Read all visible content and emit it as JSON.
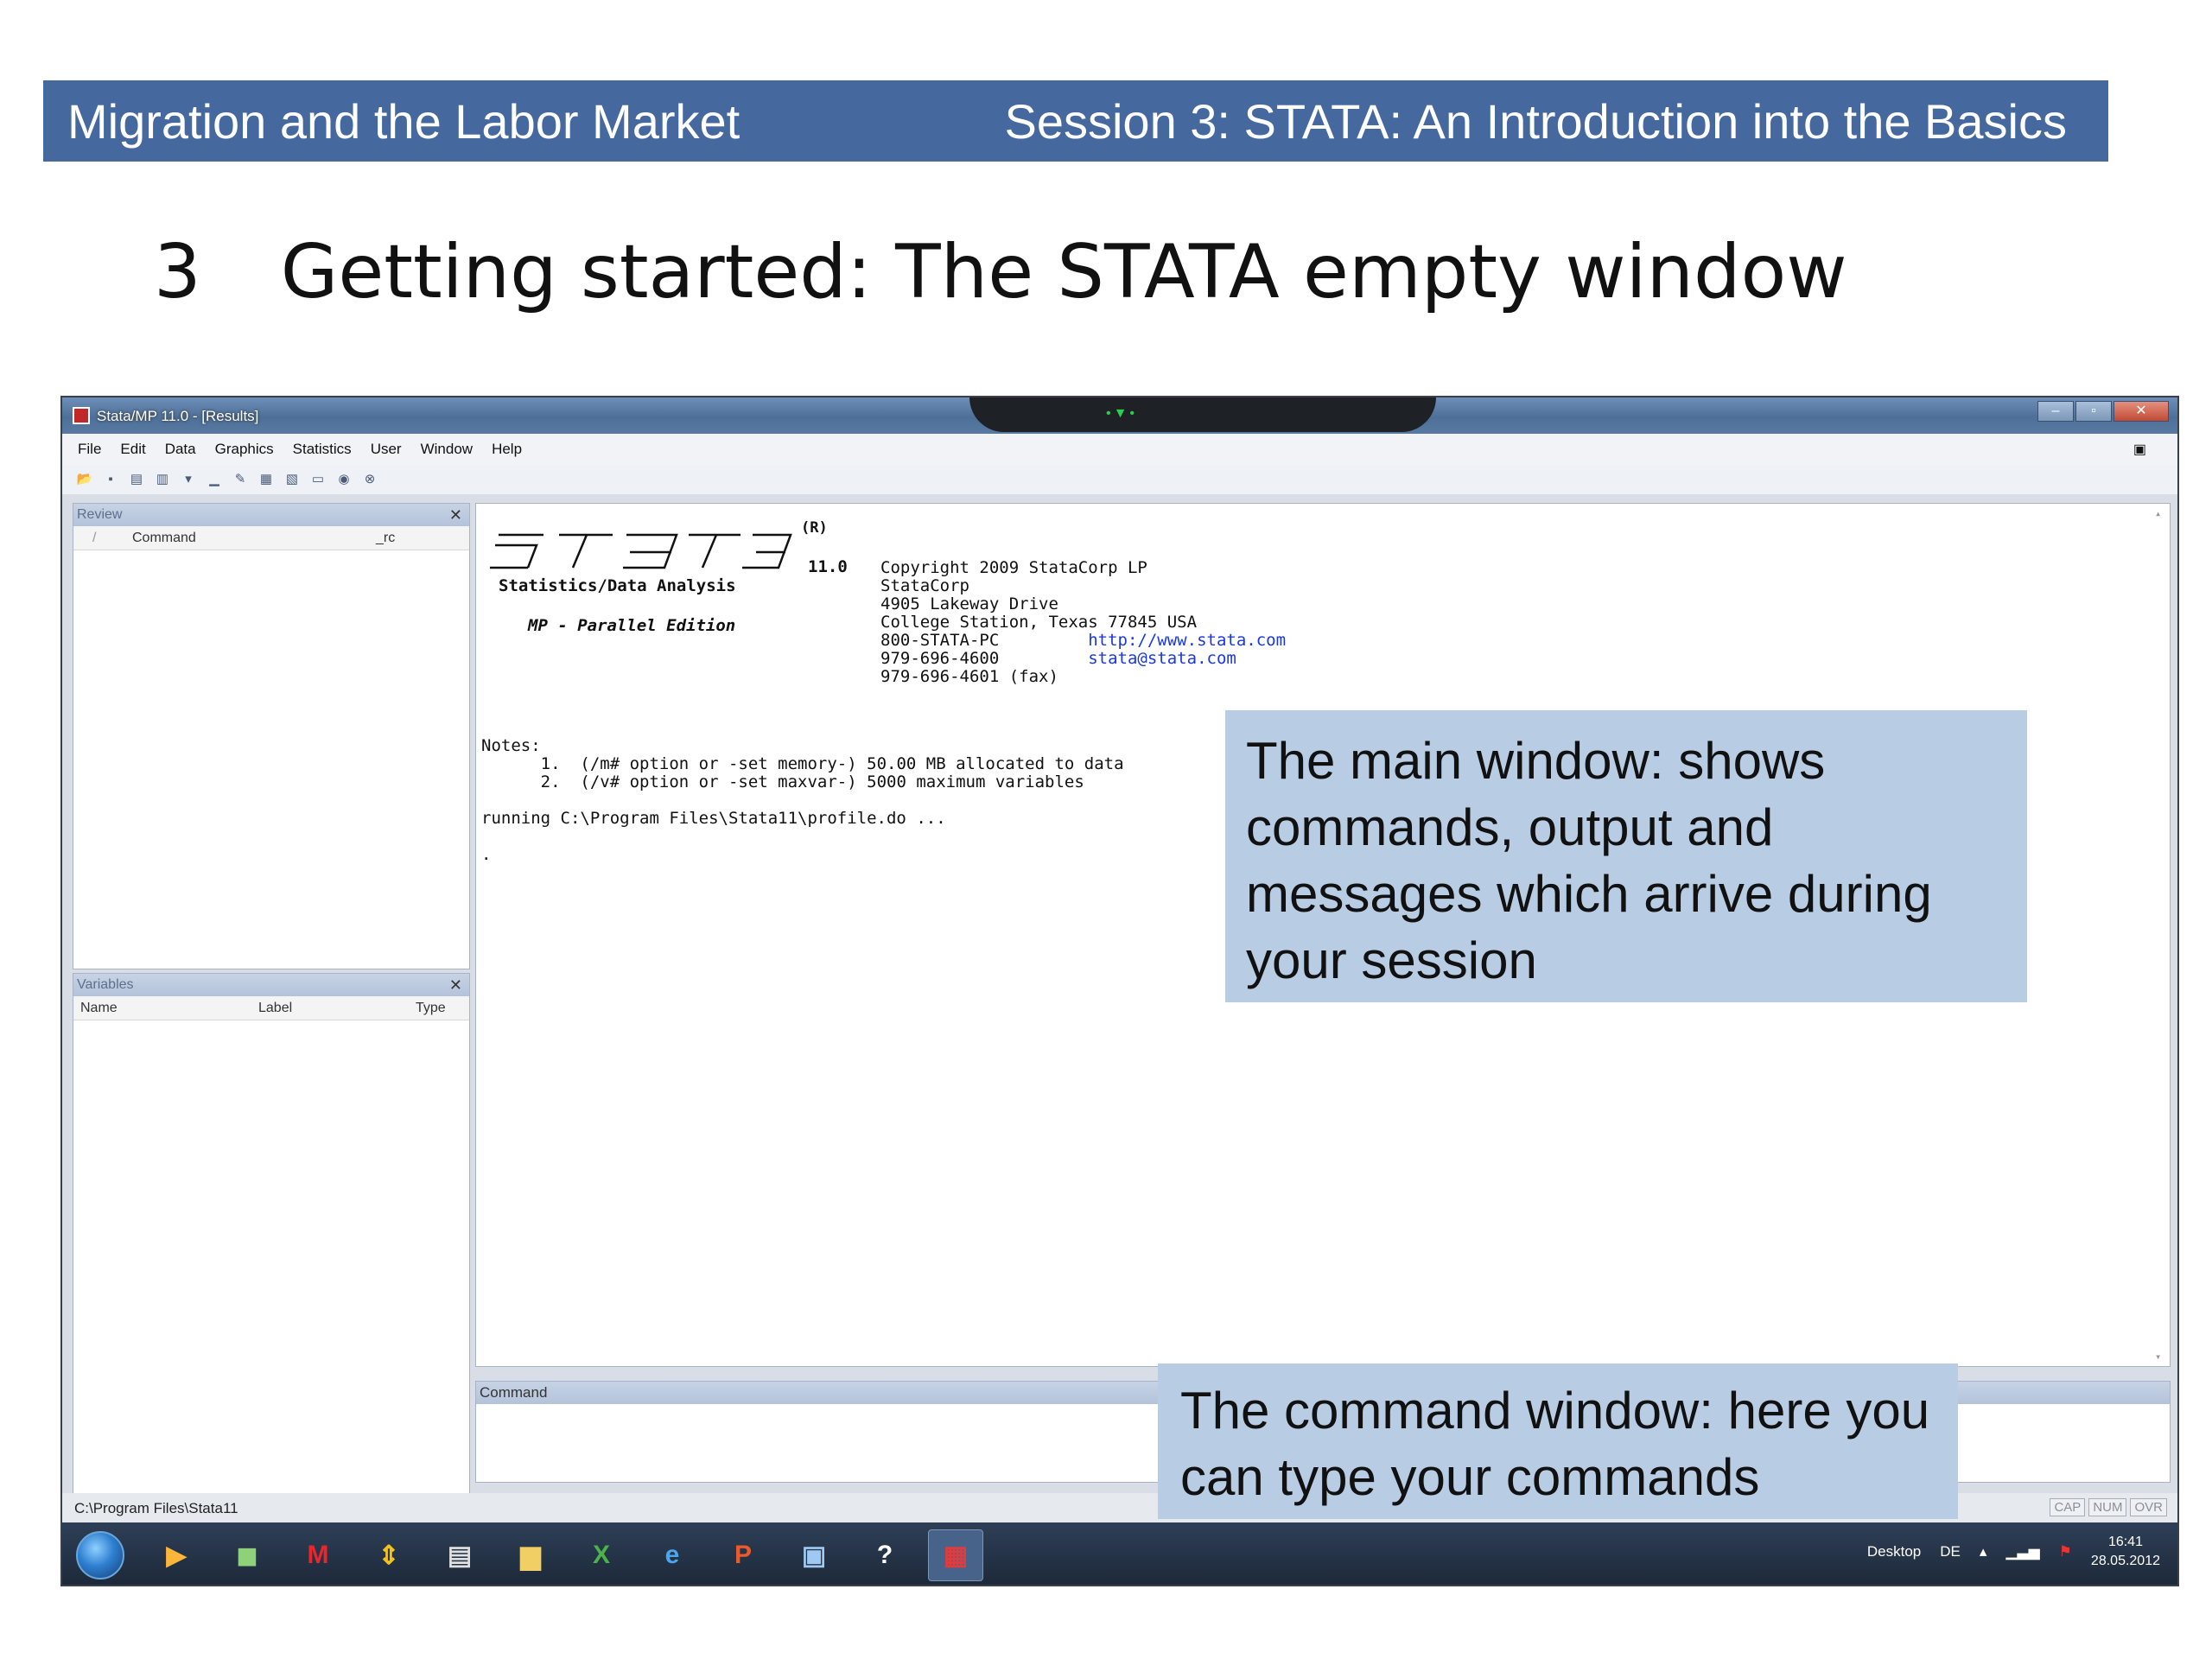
{
  "slide": {
    "header_left": "Migration and the Labor Market",
    "header_right": "Session 3: STATA: An Introduction into the Basics",
    "section_number": "3",
    "title": "Getting started: The STATA empty window"
  },
  "window": {
    "title": "Stata/MP 11.0 - [Results]",
    "menu": [
      "File",
      "Edit",
      "Data",
      "Graphics",
      "Statistics",
      "User",
      "Window",
      "Help"
    ]
  },
  "review": {
    "title": "Review",
    "columns": [
      "/",
      "Command",
      "_rc"
    ]
  },
  "variables": {
    "title": "Variables",
    "columns": [
      "Name",
      "Label",
      "Type"
    ]
  },
  "results": {
    "registered": "(R)",
    "version": "11.0",
    "subtitle": "Statistics/Data Analysis",
    "edition": "MP - Parallel Edition",
    "copyright_lines": [
      "Copyright 2009 StataCorp LP",
      "StataCorp",
      "4905 Lakeway Drive",
      "College Station, Texas 77845 USA",
      "800-STATA-PC",
      "979-696-4600",
      "979-696-4601 (fax)"
    ],
    "url": "http://www.stata.com",
    "email": "stata@stata.com",
    "notes_label": "Notes:",
    "note_1": "1.  (/m# option or -set memory-) 50.00 MB allocated to data",
    "note_2": "2.  (/v# option or -set maxvar-) 5000 maximum variables",
    "running": "running C:\\Program Files\\Stata11\\profile.do ...",
    "prompt": "."
  },
  "command": {
    "title": "Command"
  },
  "status": {
    "path": "C:\\Program Files\\Stata11",
    "flags": [
      "CAP",
      "NUM",
      "OVR"
    ]
  },
  "taskbar": {
    "desktop": "Desktop",
    "language": "DE",
    "time": "16:41",
    "date": "28.05.2012"
  },
  "callouts": {
    "main": "The main window: shows commands, output  and messages which arrive during your session",
    "command": "The command window:  here you can type your commands"
  }
}
